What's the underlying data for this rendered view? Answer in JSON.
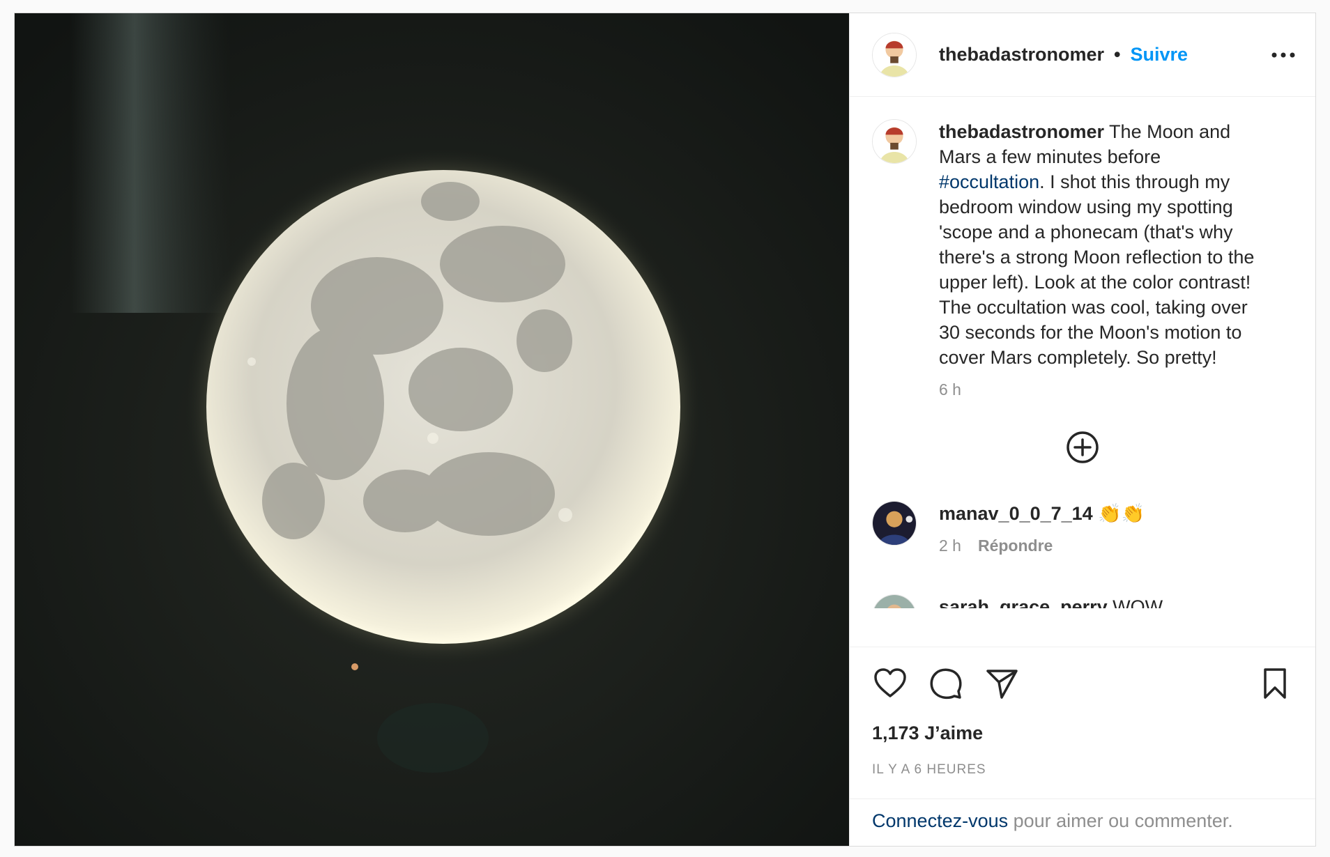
{
  "post": {
    "author": "thebadastronomer",
    "follow_separator": "•",
    "follow_label": "Suivre",
    "caption_user": "thebadastronomer",
    "caption_part1": " The Moon and Mars a few minutes before ",
    "caption_hashtag": "#occultation",
    "caption_part2": ". I shot this through my bedroom window using my spotting 'scope and a phonecam (that's why there's a strong Moon reflection to the upper left). Look at the color contrast! The occultation was cool, taking over 30 seconds for the Moon's motion to cover Mars completely. So pretty!",
    "caption_time": "6 h",
    "likes": "1,173 J’aime",
    "posted_time": "IL Y A 6 HEURES"
  },
  "comments": [
    {
      "user": "manav_0_0_7_14",
      "text": " 👏👏",
      "time": "2 h",
      "reply_label": "Répondre"
    },
    {
      "user": "sarah_grace_perry",
      "text": " WOW"
    }
  ],
  "login": {
    "link_label": "Connectez-vous",
    "rest": " pour aimer ou commenter."
  },
  "icons": {
    "more": "more-options-icon",
    "load_more": "plus-circle-icon",
    "like": "heart-icon",
    "comment": "comment-icon",
    "share": "paper-plane-icon",
    "save": "bookmark-icon"
  },
  "colors": {
    "accent": "#0095f6",
    "link": "#00376b",
    "muted": "#8e8e8e",
    "text": "#262626"
  }
}
